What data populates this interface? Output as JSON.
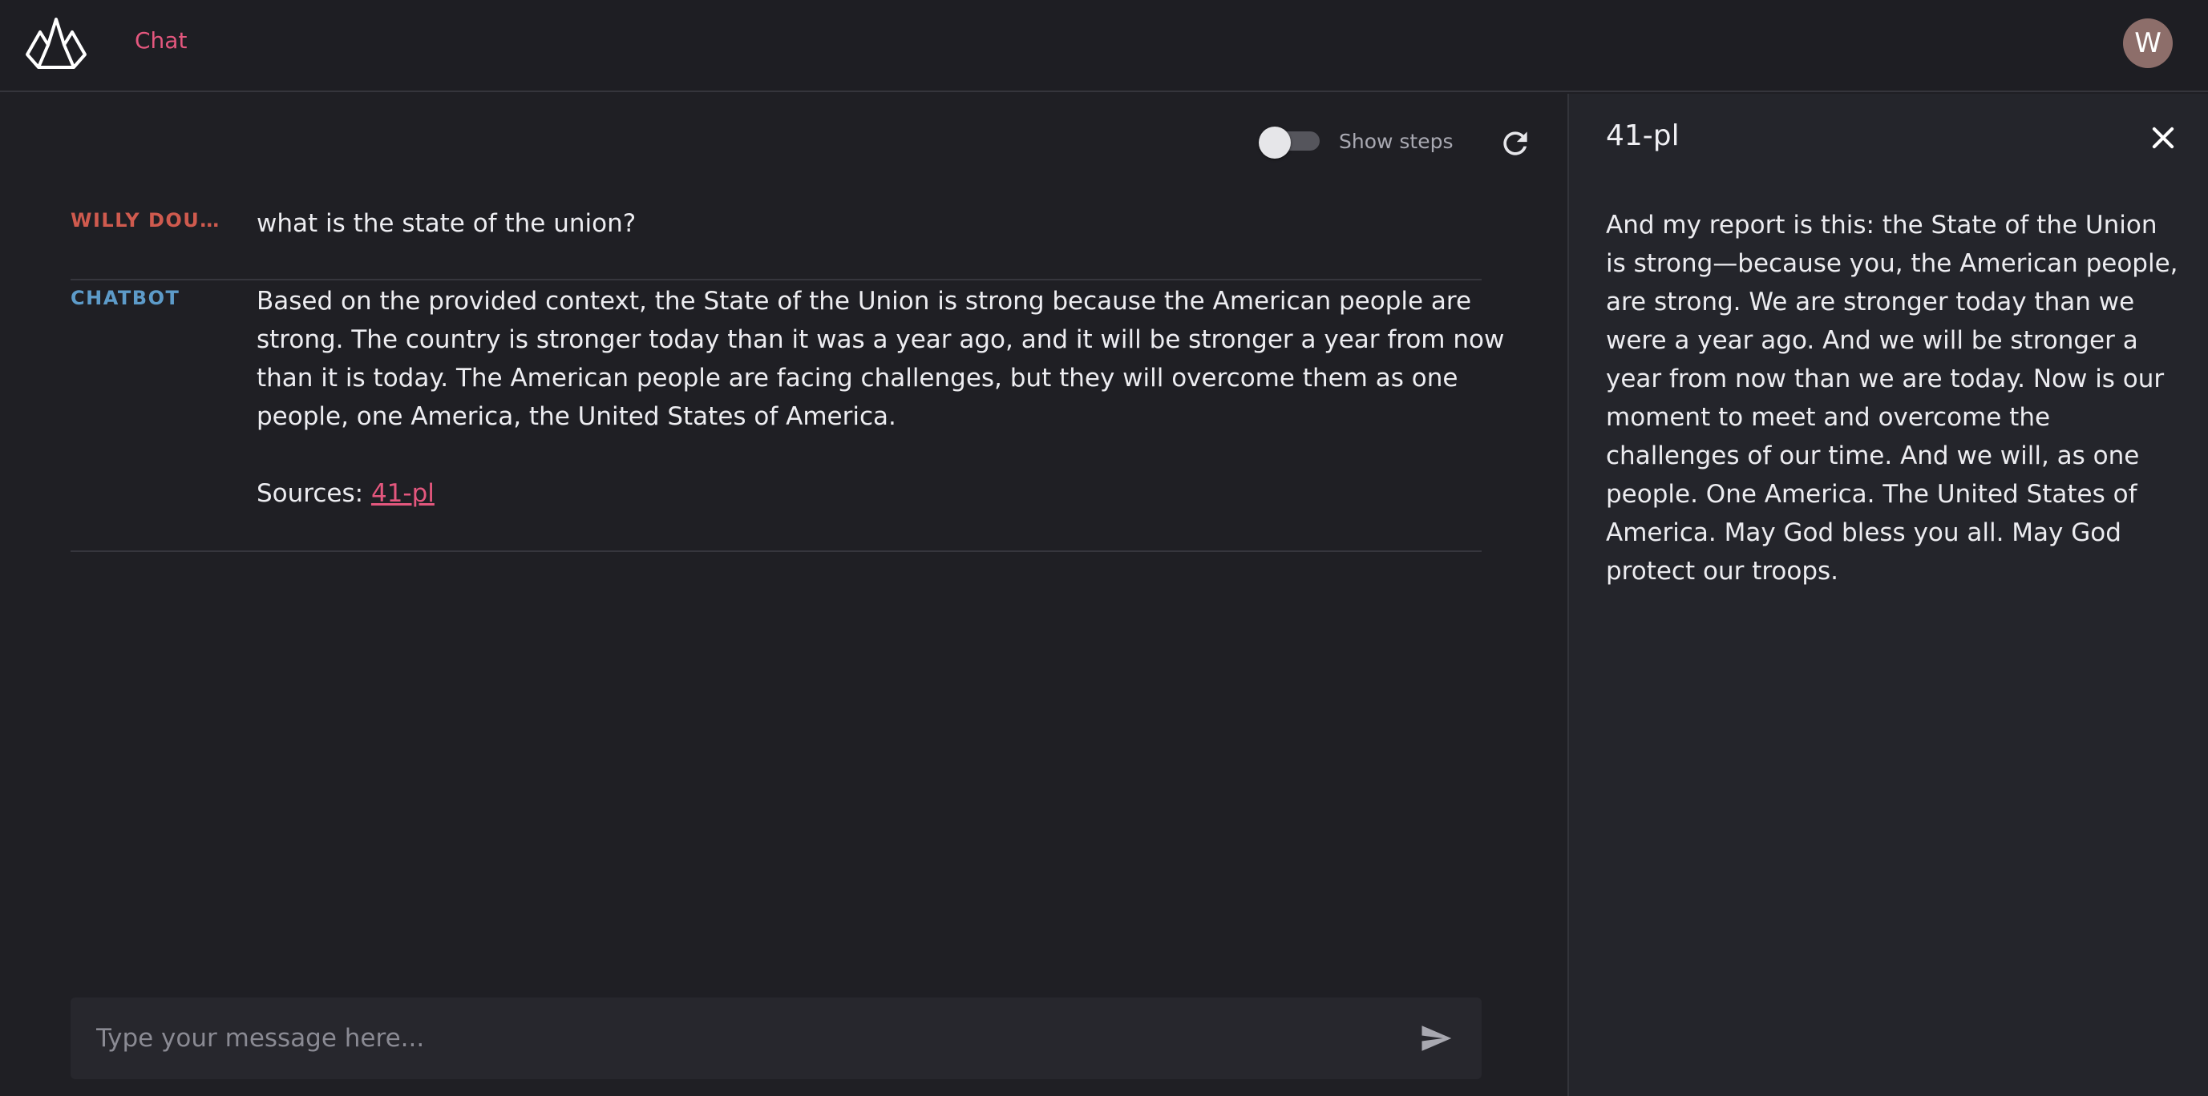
{
  "header": {
    "nav_chat_label": "Chat",
    "avatar_initial": "W"
  },
  "toolbar": {
    "show_steps_label": "Show steps",
    "show_steps_enabled": false
  },
  "messages": [
    {
      "author": "WILLY DOUH...",
      "text": "what is the state of the union?"
    },
    {
      "author": "CHATBOT",
      "text": "Based on the provided context, the State of the Union is strong because the American people are strong. The country is stronger today than it was a year ago, and it will be stronger a year from now than it is today. The American people are facing challenges, but they will overcome them as one people, one America, the United States of America.",
      "sources_label": "Sources:",
      "source_link": "41-pl"
    }
  ],
  "input": {
    "placeholder": "Type your message here..."
  },
  "side_panel": {
    "title": "41-pl",
    "content": "And my report is this: the State of the Union is strong—because you, the American people, are strong. We are stronger today than we were a year ago. And we will be stronger a year from now than we are today. Now is our moment to meet and overcome the challenges of our time. And we will, as one people. One America. The United States of America. May God bless you all. May God protect our troops."
  },
  "colors": {
    "accent": "#e4577e",
    "user_author": "#cf5a4e",
    "bot_author": "#5d9bc9",
    "background": "#1f1f24",
    "panel_background": "#24252b"
  },
  "icons": [
    "app-logo-icon",
    "refresh-icon",
    "send-icon",
    "close-icon"
  ]
}
